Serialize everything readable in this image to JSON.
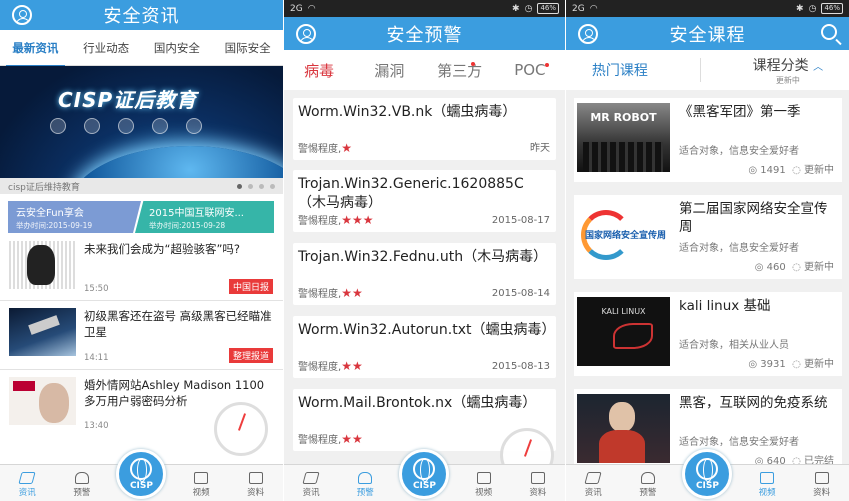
{
  "panel1": {
    "title": "安全资讯",
    "tabs": [
      "最新资讯",
      "行业动态",
      "国内安全",
      "国际安全"
    ],
    "banner_logo": "CISP证后教育",
    "banner_caption": "cisp证后维持教育",
    "promos": [
      {
        "title": "云安全Fun享会",
        "subtitle": "举办时间:2015-09-19"
      },
      {
        "title": "2015中国互联网安...",
        "subtitle": "举办时间:2015-09-28"
      }
    ],
    "news": [
      {
        "headline": "未来我们会成为“超验骇客”吗?",
        "time": "15:50",
        "tag": "中国日报"
      },
      {
        "headline": "初级黑客还在盗号 高级黑客已经瞄准卫星",
        "time": "14:11",
        "tag": "整理报道"
      },
      {
        "headline": "婚外情网站Ashley Madison 1100多万用户弱密码分析",
        "time": "13:40",
        "tag": ""
      }
    ],
    "nav": [
      "资讯",
      "预警",
      "CISP",
      "视频",
      "资料"
    ]
  },
  "panel2": {
    "status": {
      "signal": "2G",
      "battery": "46%"
    },
    "title": "安全预警",
    "tabs": [
      "病毒",
      "漏洞",
      "第三方",
      "POC"
    ],
    "level_label": "警惕程度,",
    "warnings": [
      {
        "title": "Worm.Win32.VB.nk（蠕虫病毒）",
        "level": 1,
        "stars": "★",
        "date": "昨天"
      },
      {
        "title": "Trojan.Win32.Generic.1620885C（木马病毒）",
        "level": 3,
        "stars": "★★★",
        "date": "2015-08-17"
      },
      {
        "title": "Trojan.Win32.Fednu.uth（木马病毒）",
        "level": 2,
        "stars": "★★",
        "date": "2015-08-14"
      },
      {
        "title": "Worm.Win32.Autorun.txt（蠕虫病毒）",
        "level": 2,
        "stars": "★★",
        "date": "2015-08-13"
      },
      {
        "title": "Worm.Mail.Brontok.nx（蠕虫病毒）",
        "level": 2,
        "stars": "★★",
        "date": ""
      }
    ],
    "nav": [
      "资讯",
      "预警",
      "CISP",
      "视频",
      "资料"
    ]
  },
  "panel3": {
    "status": {
      "signal": "2G",
      "battery": "46%"
    },
    "title": "安全课程",
    "tab_hot": "热门课程",
    "tab_category": "课程分类",
    "tab_category_sub": "更新中",
    "courses": [
      {
        "title": "《黑客军团》第一季",
        "audience": "适合对象，信息安全爱好者",
        "views": "1491",
        "status": "更新中",
        "photo_text": "MR ROBOT"
      },
      {
        "title": "第二届国家网络安全宣传周",
        "audience": "适合对象，信息安全爱好者",
        "views": "460",
        "status": "更新中",
        "photo_text": "国家网络安全宣传周"
      },
      {
        "title": "kali linux 基础",
        "audience": "适合对象，相关从业人员",
        "views": "3931",
        "status": "更新中",
        "photo_text": "KALI LINUX"
      },
      {
        "title": "黑客，互联网的免疫系统",
        "audience": "适合对象，信息安全爱好者",
        "views": "640",
        "status": "已完结",
        "photo_text": ""
      }
    ],
    "nav": [
      "资讯",
      "预警",
      "CISP",
      "视频",
      "资料"
    ]
  },
  "colors": {
    "primary": "#3b9ddf",
    "accent_red": "#d9363e",
    "tag_red": "#e93a3a"
  }
}
